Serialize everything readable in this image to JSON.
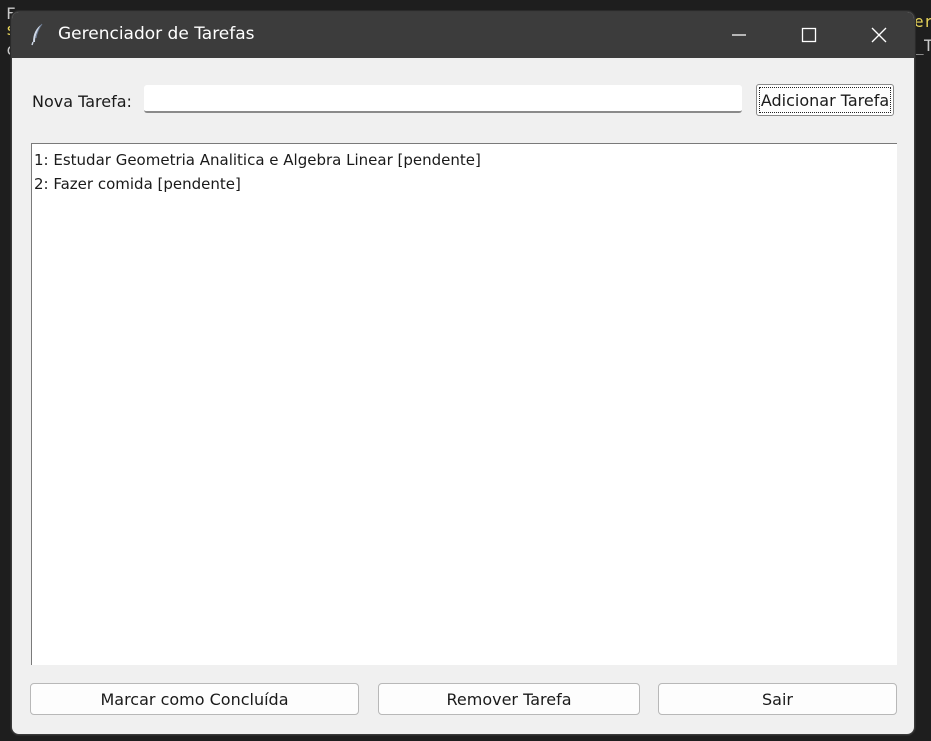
{
  "window": {
    "title": "Gerenciador de Tarefas"
  },
  "form": {
    "label": "Nova Tarefa:",
    "input_value": "",
    "add_button": "Adicionar Tarefa"
  },
  "tasks": [
    "1: Estudar Geometria Analitica e Algebra Linear [pendente]",
    "2: Fazer comida [pendente]"
  ],
  "actions": {
    "mark_done": "Marcar como Concluída",
    "remove": "Remover Tarefa",
    "exit": "Sair"
  },
  "colors": {
    "titlebar": "#3c3c3c",
    "window_bg": "#f0f0f0",
    "list_bg": "#ffffff"
  }
}
